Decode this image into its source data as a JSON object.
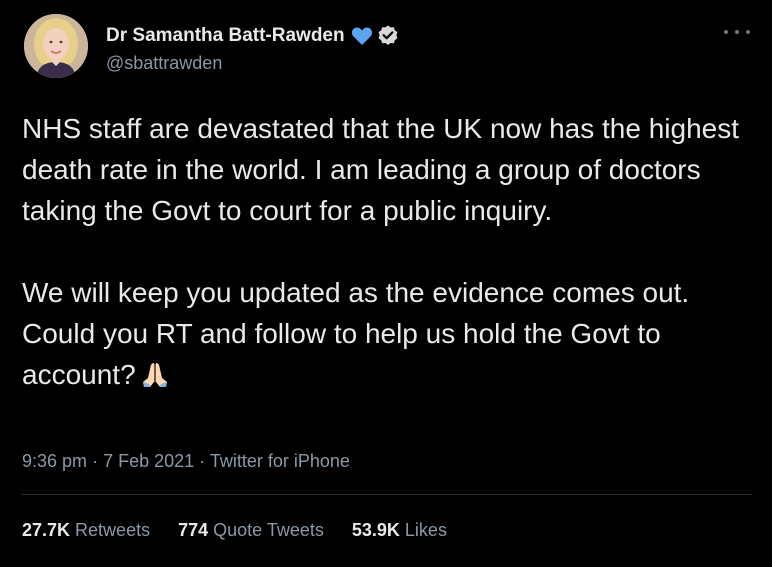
{
  "author": {
    "display_name": "Dr Samantha Batt-Rawden",
    "handle": "@sbattrawden",
    "avatar_icon": "profile-photo",
    "heart_icon_color": "#5aa4f0",
    "verified_icon": "verified-badge"
  },
  "tweet": {
    "paragraph_1": "NHS staff are devastated that the UK now has the highest death rate in the world. I am leading a group of doctors taking the Govt to court for a public inquiry.",
    "paragraph_2": "We will keep you updated as the evidence comes out. Could you RT and follow to help us hold the Govt to account?",
    "emoji": "folded-hands-emoji"
  },
  "meta": {
    "time": "9:36 pm",
    "separator": "·",
    "date": "7 Feb 2021",
    "source": "Twitter for iPhone"
  },
  "stats": {
    "retweets_count": "27.7K",
    "retweets_label": "Retweets",
    "quotes_count": "774",
    "quotes_label": "Quote Tweets",
    "likes_count": "53.9K",
    "likes_label": "Likes"
  },
  "colors": {
    "background": "#000000",
    "text": "#e7e9ea",
    "muted": "#8b98a5",
    "divider": "#2f3336"
  }
}
